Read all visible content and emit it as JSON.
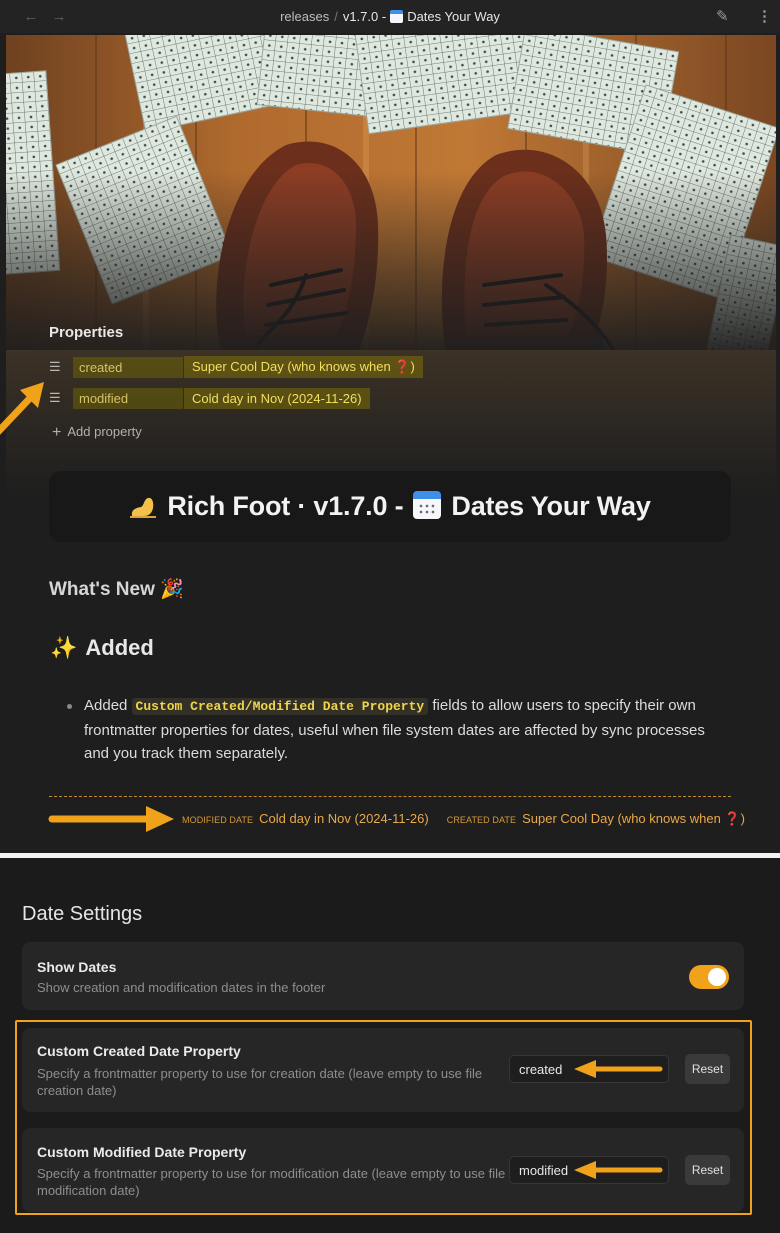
{
  "titlebar": {
    "back_icon": "arrow-left-icon",
    "forward_icon": "arrow-right-icon",
    "breadcrumb_parent": "releases",
    "breadcrumb_separator": "/",
    "breadcrumb_version": "v1.7.0 -",
    "breadcrumb_title": "Dates Your Way",
    "edit_icon": "pencil-icon",
    "more_icon": "more-vertical-icon"
  },
  "properties": {
    "heading": "Properties",
    "items": [
      {
        "key": "created",
        "value": "Super Cool Day (who knows when ❓)"
      },
      {
        "key": "modified",
        "value": "Cold day in Nov (2024-11-26)"
      }
    ],
    "add_label": "Add property"
  },
  "note": {
    "title_part1": "Rich Foot · v1.7.0 -",
    "title_part2": "Dates Your Way",
    "whats_new": "What's New 🎉",
    "added_heading": "Added",
    "bullet_prefix": "Added",
    "bullet_code": "Custom Created/Modified Date Property",
    "bullet_suffix": "fields to allow users to specify their own frontmatter properties for dates, useful when file system dates are affected by sync processes and you track them separately."
  },
  "footer": {
    "modified_label": "MODIFIED DATE",
    "modified_value": "Cold day in Nov (2024-11-26)",
    "created_label": "CREATED DATE",
    "created_value": "Super Cool Day (who knows when ❓)"
  },
  "settings": {
    "heading": "Date Settings",
    "show_dates": {
      "name": "Show Dates",
      "desc": "Show creation and modification dates in the footer",
      "enabled": true
    },
    "created_prop": {
      "name": "Custom Created Date Property",
      "desc": "Specify a frontmatter property to use for creation date (leave empty to use file creation date)",
      "value": "created",
      "reset_label": "Reset"
    },
    "modified_prop": {
      "name": "Custom Modified Date Property",
      "desc": "Specify a frontmatter property to use for modification date (leave empty to use file modification date)",
      "value": "modified",
      "reset_label": "Reset"
    }
  },
  "colors": {
    "accent": "#f0a21b",
    "highlight_value": "#f2df62",
    "footer_text": "#e8a94c"
  }
}
